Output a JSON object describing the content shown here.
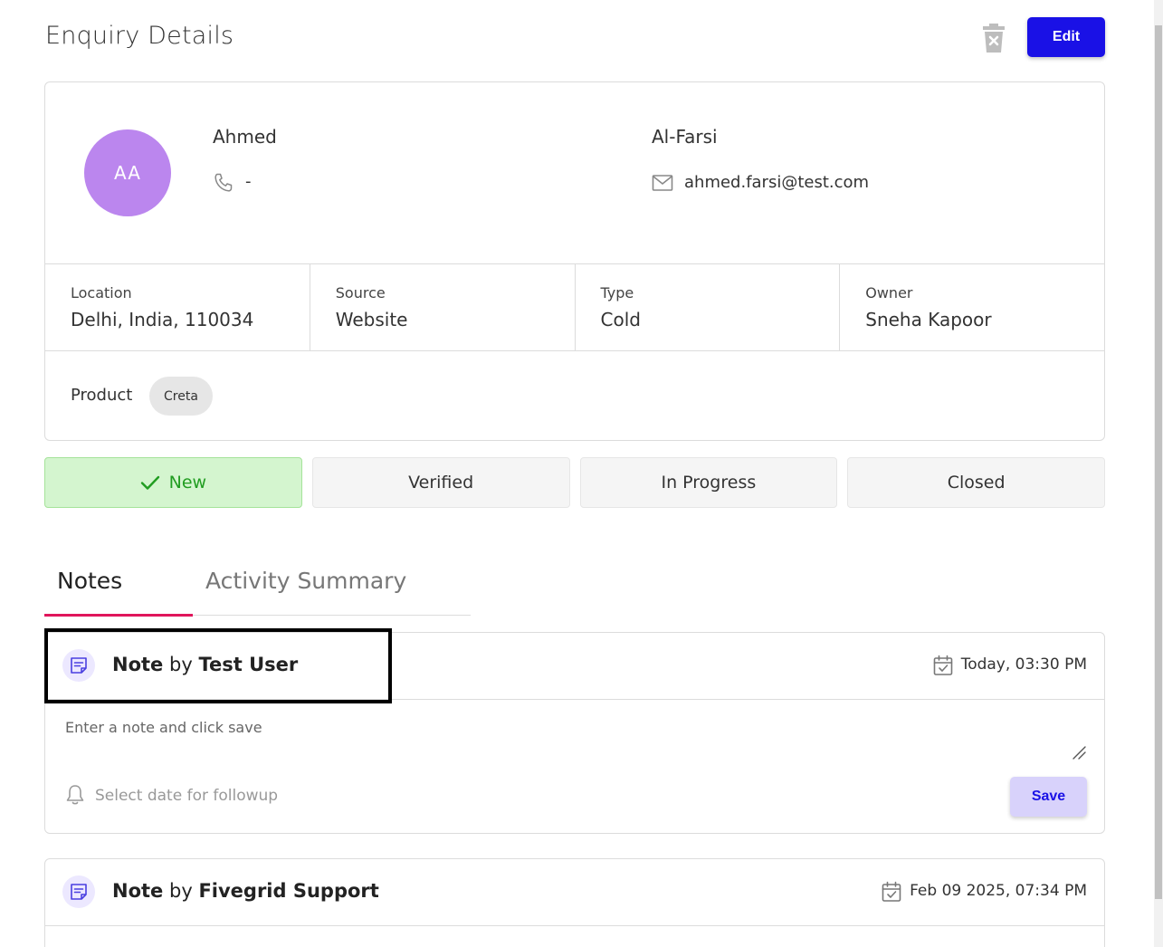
{
  "header": {
    "title": "Enquiry Details",
    "edit_label": "Edit",
    "delete_icon": "trash-icon"
  },
  "contact": {
    "initials": "AA",
    "avatar_color": "#bb86ee",
    "first_name": "Ahmed",
    "last_name": "Al-Farsi",
    "phone": "-",
    "email": "ahmed.farsi@test.com"
  },
  "details": [
    {
      "label": "Location",
      "value": "Delhi, India, 110034"
    },
    {
      "label": "Source",
      "value": "Website"
    },
    {
      "label": "Type",
      "value": "Cold"
    },
    {
      "label": "Owner",
      "value": "Sneha Kapoor"
    }
  ],
  "product": {
    "label": "Product",
    "chip": "Creta"
  },
  "statuses": [
    {
      "label": "New",
      "active": true
    },
    {
      "label": "Verified",
      "active": false
    },
    {
      "label": "In Progress",
      "active": false
    },
    {
      "label": "Closed",
      "active": false
    }
  ],
  "tabs": {
    "notes": "Notes",
    "activity": "Activity Summary",
    "accent": "#e0155b"
  },
  "notes": [
    {
      "prefix": "Note",
      "by": "by",
      "author": "Test User",
      "date": "Today, 03:30 PM",
      "placeholder": "Enter a note and click save",
      "followup": "Select date for followup",
      "save_label": "Save"
    },
    {
      "prefix": "Note",
      "by": "by",
      "author": "Fivegrid Support",
      "date": "Feb 09 2025, 07:34 PM"
    }
  ],
  "colors": {
    "primary": "#1a11e6",
    "success_bg": "#d4f5cf",
    "success_text": "#219d21"
  }
}
